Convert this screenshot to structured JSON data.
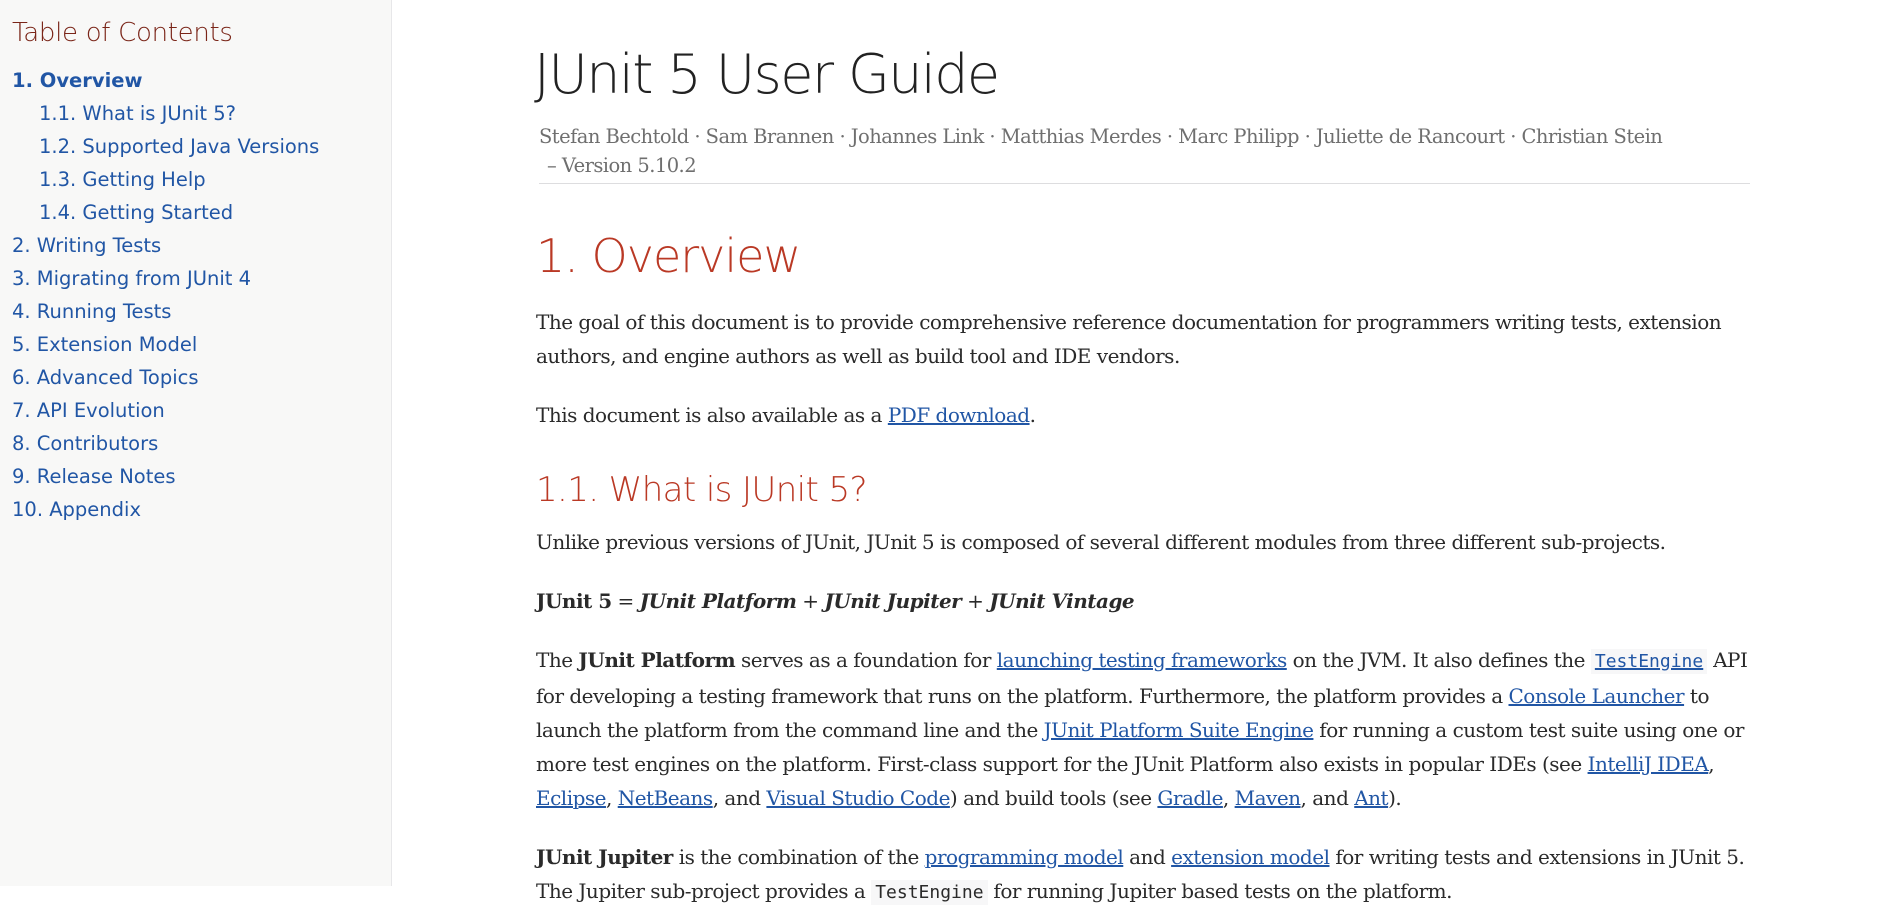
{
  "toc": {
    "title": "Table of Contents",
    "items": [
      {
        "label": "1. Overview",
        "level": 1,
        "active": true
      },
      {
        "label": "1.1. What is JUnit 5?",
        "level": 2
      },
      {
        "label": "1.2. Supported Java Versions",
        "level": 2
      },
      {
        "label": "1.3. Getting Help",
        "level": 2
      },
      {
        "label": "1.4. Getting Started",
        "level": 2
      },
      {
        "label": "2. Writing Tests",
        "level": 1
      },
      {
        "label": "3. Migrating from JUnit 4",
        "level": 1
      },
      {
        "label": "4. Running Tests",
        "level": 1
      },
      {
        "label": "5. Extension Model",
        "level": 1
      },
      {
        "label": "6. Advanced Topics",
        "level": 1
      },
      {
        "label": "7. API Evolution",
        "level": 1
      },
      {
        "label": "8. Contributors",
        "level": 1
      },
      {
        "label": "9. Release Notes",
        "level": 1
      },
      {
        "label": "10. Appendix",
        "level": 1
      }
    ]
  },
  "header": {
    "title": "JUnit 5 User Guide",
    "authors": "Stefan Bechtold · Sam Brannen · Johannes Link · Matthias Merdes · Marc Philipp · Juliette de Rancourt · Christian Stein",
    "revision": "– Version 5.10.2"
  },
  "overview": {
    "heading": "1. Overview",
    "p1": "The goal of this document is to provide comprehensive reference documentation for programmers writing tests, extension authors, and engine authors as well as build tool and IDE vendors.",
    "p2_before": "This document is also available as a ",
    "p2_link": "PDF download",
    "p2_after": "."
  },
  "what_is": {
    "heading": "1.1. What is JUnit 5?",
    "p1": "Unlike previous versions of JUnit, JUnit 5 is composed of several different modules from three different sub-projects.",
    "formula": {
      "lhs": "JUnit 5",
      "eq": " = ",
      "platform": "JUnit Platform",
      "plus": " + ",
      "jupiter": "JUnit Jupiter",
      "vintage": "JUnit Vintage"
    },
    "platform_para": {
      "t1": "The ",
      "b1": "JUnit Platform",
      "t2": " serves as a foundation for ",
      "l1": "launching testing frameworks",
      "t3": " on the JVM. It also defines the ",
      "code1": "TestEngine",
      "t4": " API for developing a testing framework that runs on the platform. Furthermore, the platform provides a ",
      "l2": "Console Launcher",
      "t5": " to launch the platform from the command line and the ",
      "l3": "JUnit Platform Suite Engine",
      "t6": " for running a custom test suite using one or more test engines on the platform. First-class support for the JUnit Platform also exists in popular IDEs (see ",
      "l4": "IntelliJ IDEA",
      "sep1": ", ",
      "l5": "Eclipse",
      "sep2": ", ",
      "l6": "NetBeans",
      "sep3": ", and ",
      "l7": "Visual Studio Code",
      "t7": ") and build tools (see ",
      "l8": "Gradle",
      "sep4": ", ",
      "l9": "Maven",
      "sep5": ", and ",
      "l10": "Ant",
      "t8": ")."
    },
    "jupiter_para": {
      "b1": "JUnit Jupiter",
      "t1": " is the combination of the ",
      "l1": "programming model",
      "t2": " and ",
      "l2": "extension model",
      "t3": " for writing tests and extensions in JUnit 5. The Jupiter sub-project provides a ",
      "code1": "TestEngine",
      "t4": " for running Jupiter based tests on the platform."
    }
  }
}
